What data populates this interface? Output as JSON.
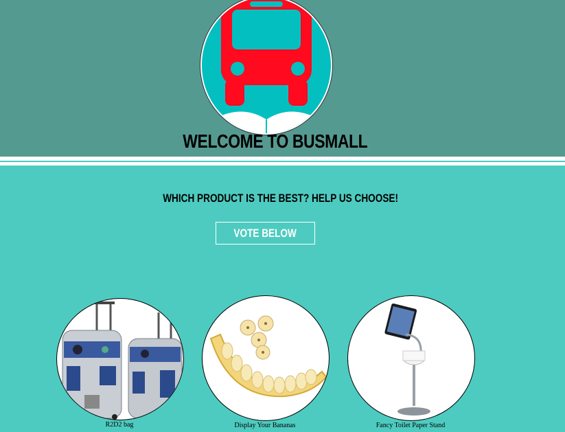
{
  "header": {
    "logo_icon": "bus-icon",
    "title": "Welcome to BusMall",
    "colors": {
      "band": "#559a90",
      "logo_background": "#03bfc0",
      "bus": "#ff0a1e"
    }
  },
  "main": {
    "question": "Which product is the best? Help us choose!",
    "vote_label": "Vote Below",
    "background": "#4ecbc0"
  },
  "products": [
    {
      "caption": "R2D2 bag",
      "icon": "r2d2-luggage-image"
    },
    {
      "caption": "Display Your Bananas",
      "icon": "banana-slicer-image"
    },
    {
      "caption": "Fancy Toilet Paper Stand",
      "icon": "toilet-paper-stand-image"
    }
  ]
}
